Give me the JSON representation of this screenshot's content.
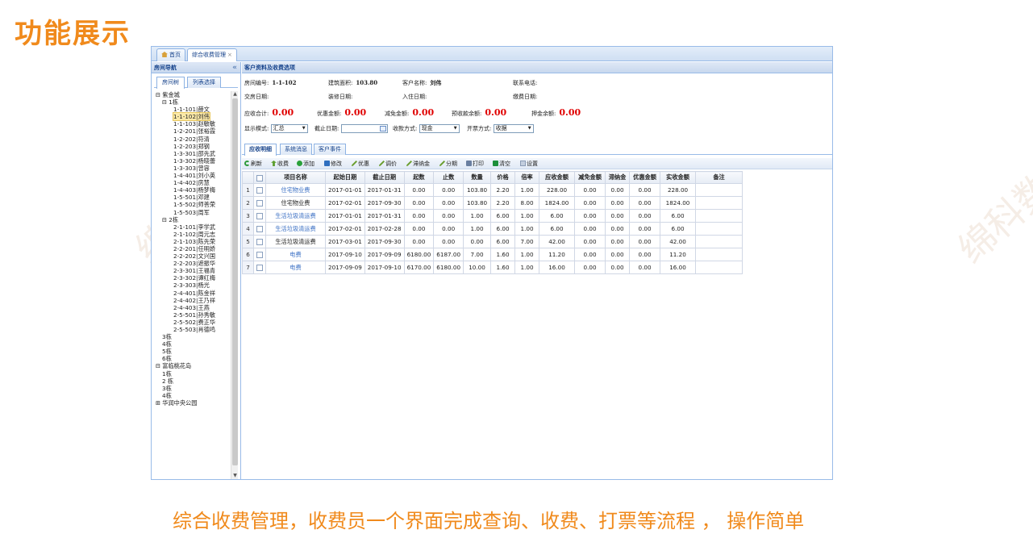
{
  "slide": {
    "title": "功能展示",
    "caption": "综合收费管理，收费员一个界面完成查询、收费、打票等流程 ， 操作简单",
    "watermark": "绵科数服"
  },
  "tabs": [
    {
      "label": "首页",
      "icon": "home-icon",
      "active": false
    },
    {
      "label": "综合收费管理",
      "close": "×",
      "active": true
    }
  ],
  "nav": {
    "title": "房间导航",
    "collapse": "«",
    "tabs": [
      "房间树",
      "列表选择"
    ],
    "tree": [
      {
        "label": "⊟ 紫金城",
        "indent": 0
      },
      {
        "label": "⊟ 1栋",
        "indent": 1
      },
      {
        "label": "1-1-101|薛文",
        "indent": 2
      },
      {
        "label": "1-1-102|刘伟",
        "indent": 2,
        "selected": true
      },
      {
        "label": "1-1-103|赵敏敏",
        "indent": 2
      },
      {
        "label": "1-2-201|张裕霞",
        "indent": 2
      },
      {
        "label": "1-2-202|符清",
        "indent": 2
      },
      {
        "label": "1-2-203|郑钢",
        "indent": 2
      },
      {
        "label": "1-3-301|邵先武",
        "indent": 2
      },
      {
        "label": "1-3-302|杨晓蕾",
        "indent": 2
      },
      {
        "label": "1-3-303|曾容",
        "indent": 2
      },
      {
        "label": "1-4-401|刘小英",
        "indent": 2
      },
      {
        "label": "1-4-402|房慧",
        "indent": 2
      },
      {
        "label": "1-4-403|杨梦梅",
        "indent": 2
      },
      {
        "label": "1-5-501|邓建",
        "indent": 2
      },
      {
        "label": "1-5-502|师善荣",
        "indent": 2
      },
      {
        "label": "1-5-503|周军",
        "indent": 2
      },
      {
        "label": "⊟ 2栋",
        "indent": 1
      },
      {
        "label": "2-1-101|李学武",
        "indent": 2
      },
      {
        "label": "2-1-102|周元志",
        "indent": 2
      },
      {
        "label": "2-1-103|陈先荣",
        "indent": 2
      },
      {
        "label": "2-2-201|任明娇",
        "indent": 2
      },
      {
        "label": "2-2-202|文兴国",
        "indent": 2
      },
      {
        "label": "2-2-203|遮振华",
        "indent": 2
      },
      {
        "label": "2-3-301|王福青",
        "indent": 2
      },
      {
        "label": "2-3-302|谭红梅",
        "indent": 2
      },
      {
        "label": "2-3-303|杨光",
        "indent": 2
      },
      {
        "label": "2-4-401|陈金祥",
        "indent": 2
      },
      {
        "label": "2-4-402|王乃祥",
        "indent": 2
      },
      {
        "label": "2-4-403|王燕",
        "indent": 2
      },
      {
        "label": "2-5-501|孙秀敏",
        "indent": 2
      },
      {
        "label": "2-5-502|费正华",
        "indent": 2
      },
      {
        "label": "2-5-503|肖德鸣",
        "indent": 2
      },
      {
        "label": "3栋",
        "indent": 1
      },
      {
        "label": "4栋",
        "indent": 1
      },
      {
        "label": "5栋",
        "indent": 1
      },
      {
        "label": "6栋",
        "indent": 1
      },
      {
        "label": "⊟ 富临桃花岛",
        "indent": 0
      },
      {
        "label": "1栋",
        "indent": 1
      },
      {
        "label": "2 栋",
        "indent": 1
      },
      {
        "label": "3栋",
        "indent": 1
      },
      {
        "label": "4栋",
        "indent": 1
      },
      {
        "label": "⊞ 华润中央公园",
        "indent": 0
      }
    ]
  },
  "info": {
    "section_title": "客户资料及收费选项",
    "room_no_label": "房间编号:",
    "room_no": "1-1-102",
    "area_label": "建筑面积:",
    "area": "103.80",
    "customer_label": "客户名称:",
    "customer": "刘伟",
    "phone_label": "联系电话:",
    "handover_label": "交房日期:",
    "decor_label": "装修日期:",
    "movein_label": "入住日期:",
    "pay_date_label": "缴费日期:",
    "receivable_label": "应收合计:",
    "receivable": "0.00",
    "discount_label": "优惠金额:",
    "discount": "0.00",
    "waive_label": "减免金额:",
    "waive": "0.00",
    "prepay_label": "预收款余额:",
    "prepay": "0.00",
    "deposit_label": "押金余额:",
    "deposit": "0.00",
    "mode_label": "显示模式:",
    "mode": "汇总",
    "end_date_label": "截止日期:",
    "pay_method_label": "收款方式:",
    "pay_method": "现金",
    "invoice_label": "开票方式:",
    "invoice": "收据"
  },
  "inner_tabs": [
    "应收明细",
    "系统消息",
    "客户事件"
  ],
  "toolbar": [
    "刷新",
    "收费",
    "添加",
    "修改",
    "优惠",
    "调价",
    "滞纳金",
    "分期",
    "打印",
    "清空",
    "设置"
  ],
  "grid": {
    "headers": [
      "",
      "",
      "项目名称",
      "起始日期",
      "截止日期",
      "起数",
      "止数",
      "数量",
      "价格",
      "倍率",
      "应收金额",
      "减免金额",
      "滞纳金",
      "优惠金额",
      "实收金额",
      "备注"
    ],
    "rows": [
      {
        "n": "1",
        "name": "住宅物业费",
        "link": true,
        "start": "2017-01-01",
        "end": "2017-01-31",
        "from": "0.00",
        "to": "0.00",
        "qty": "103.80",
        "price": "2.20",
        "rate": "1.00",
        "due": "228.00",
        "waive": "0.00",
        "late": "0.00",
        "disc": "0.00",
        "paid": "228.00",
        "note": ""
      },
      {
        "n": "2",
        "name": "住宅物业费",
        "link": false,
        "start": "2017-02-01",
        "end": "2017-09-30",
        "from": "0.00",
        "to": "0.00",
        "qty": "103.80",
        "price": "2.20",
        "rate": "8.00",
        "due": "1824.00",
        "waive": "0.00",
        "late": "0.00",
        "disc": "0.00",
        "paid": "1824.00",
        "note": ""
      },
      {
        "n": "3",
        "name": "生活垃圾清运费",
        "link": true,
        "start": "2017-01-01",
        "end": "2017-01-31",
        "from": "0.00",
        "to": "0.00",
        "qty": "1.00",
        "price": "6.00",
        "rate": "1.00",
        "due": "6.00",
        "waive": "0.00",
        "late": "0.00",
        "disc": "0.00",
        "paid": "6.00",
        "note": ""
      },
      {
        "n": "4",
        "name": "生活垃圾清运费",
        "link": true,
        "start": "2017-02-01",
        "end": "2017-02-28",
        "from": "0.00",
        "to": "0.00",
        "qty": "1.00",
        "price": "6.00",
        "rate": "1.00",
        "due": "6.00",
        "waive": "0.00",
        "late": "0.00",
        "disc": "0.00",
        "paid": "6.00",
        "note": ""
      },
      {
        "n": "5",
        "name": "生活垃圾清运费",
        "link": false,
        "start": "2017-03-01",
        "end": "2017-09-30",
        "from": "0.00",
        "to": "0.00",
        "qty": "0.00",
        "price": "6.00",
        "rate": "7.00",
        "due": "42.00",
        "waive": "0.00",
        "late": "0.00",
        "disc": "0.00",
        "paid": "42.00",
        "note": ""
      },
      {
        "n": "6",
        "name": "电费",
        "link": true,
        "start": "2017-09-10",
        "end": "2017-09-09",
        "from": "6180.00",
        "to": "6187.00",
        "qty": "7.00",
        "price": "1.60",
        "rate": "1.00",
        "due": "11.20",
        "waive": "0.00",
        "late": "0.00",
        "disc": "0.00",
        "paid": "11.20",
        "note": ""
      },
      {
        "n": "7",
        "name": "电费",
        "link": true,
        "start": "2017-09-09",
        "end": "2017-09-10",
        "from": "6170.00",
        "to": "6180.00",
        "qty": "10.00",
        "price": "1.60",
        "rate": "1.00",
        "due": "16.00",
        "waive": "0.00",
        "late": "0.00",
        "disc": "0.00",
        "paid": "16.00",
        "note": ""
      }
    ]
  },
  "colors": {
    "accent": "#f08a1c",
    "money": "#e00000",
    "link": "#3a6fc4",
    "border": "#99bbe8"
  }
}
